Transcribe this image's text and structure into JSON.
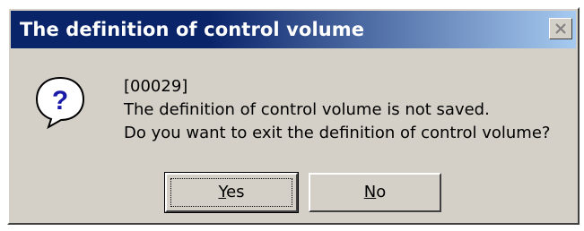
{
  "dialog": {
    "title": "The definition of control volume",
    "message": {
      "code": "[00029]",
      "line1": "The definition of control volume is not saved.",
      "line2": "Do you want to exit the definition of control volume?"
    },
    "icon": "question-icon",
    "buttons": {
      "yes": {
        "mnemonic": "Y",
        "rest": "es"
      },
      "no": {
        "mnemonic": "N",
        "rest": "o"
      }
    }
  },
  "colors": {
    "titlebar_start": "#0a246a",
    "titlebar_end": "#a6caf0",
    "face": "#d4d0c8"
  }
}
